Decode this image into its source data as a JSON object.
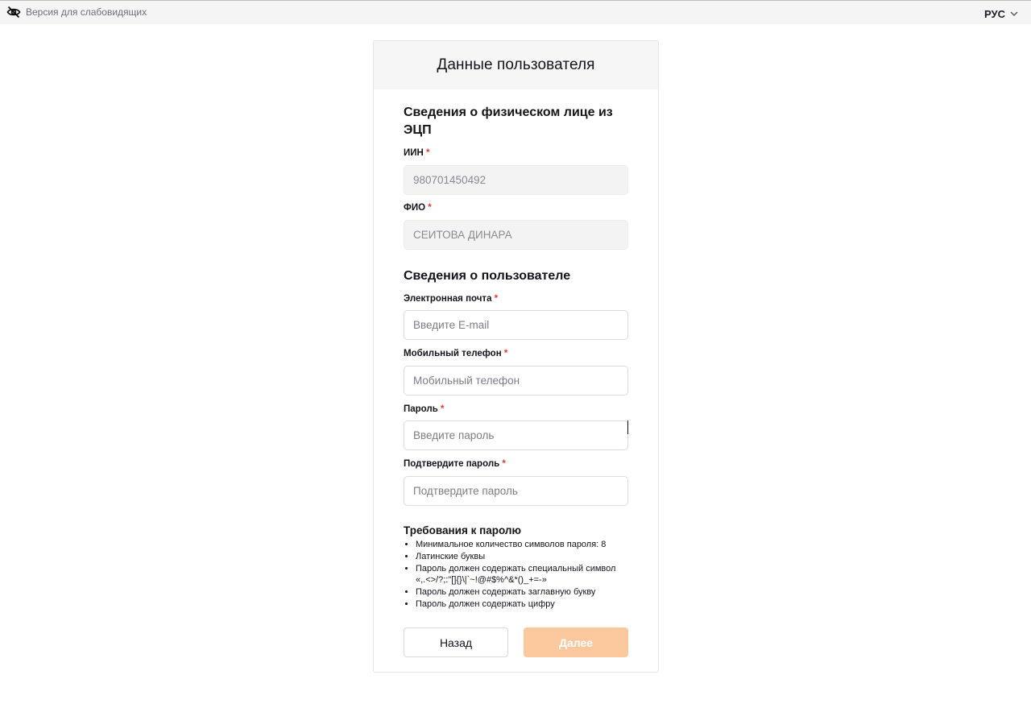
{
  "topbar": {
    "accessibility_label": "Версия для слабовидящих",
    "language": "РУС"
  },
  "card": {
    "title": "Данные пользователя"
  },
  "person_section": {
    "title": "Сведения о физическом лице из ЭЦП",
    "iin_label": "ИИН",
    "iin_value": "980701450492",
    "fio_label": "ФИО",
    "fio_value": "СЕИТОВА ДИНАРА"
  },
  "user_section": {
    "title": "Сведения о пользователе",
    "email_label": "Электронная почта",
    "email_placeholder": "Введите E-mail",
    "phone_label": "Мобильный телефон",
    "phone_placeholder": "Мобильный телефон",
    "password_label": "Пароль",
    "password_placeholder": "Введите пароль",
    "confirm_label": "Подтвердите пароль",
    "confirm_placeholder": "Подтвердите пароль"
  },
  "required_mark": "*",
  "password_requirements": {
    "title": "Требования к паролю",
    "items": [
      "Минимальное количество символов пароля: 8",
      "Латинские буквы",
      "Пароль должен содержать специальный символ",
      "Пароль должен содержать заглавную букву",
      "Пароль должен содержать цифру"
    ],
    "special_chars": "«,.<>/?;:\"[]{}\\|`~!@#$%^&*()_+=-»"
  },
  "buttons": {
    "back": "Назад",
    "next": "Далее"
  },
  "colors": {
    "accent_disabled": "#fbc99d",
    "required": "#e53935"
  }
}
